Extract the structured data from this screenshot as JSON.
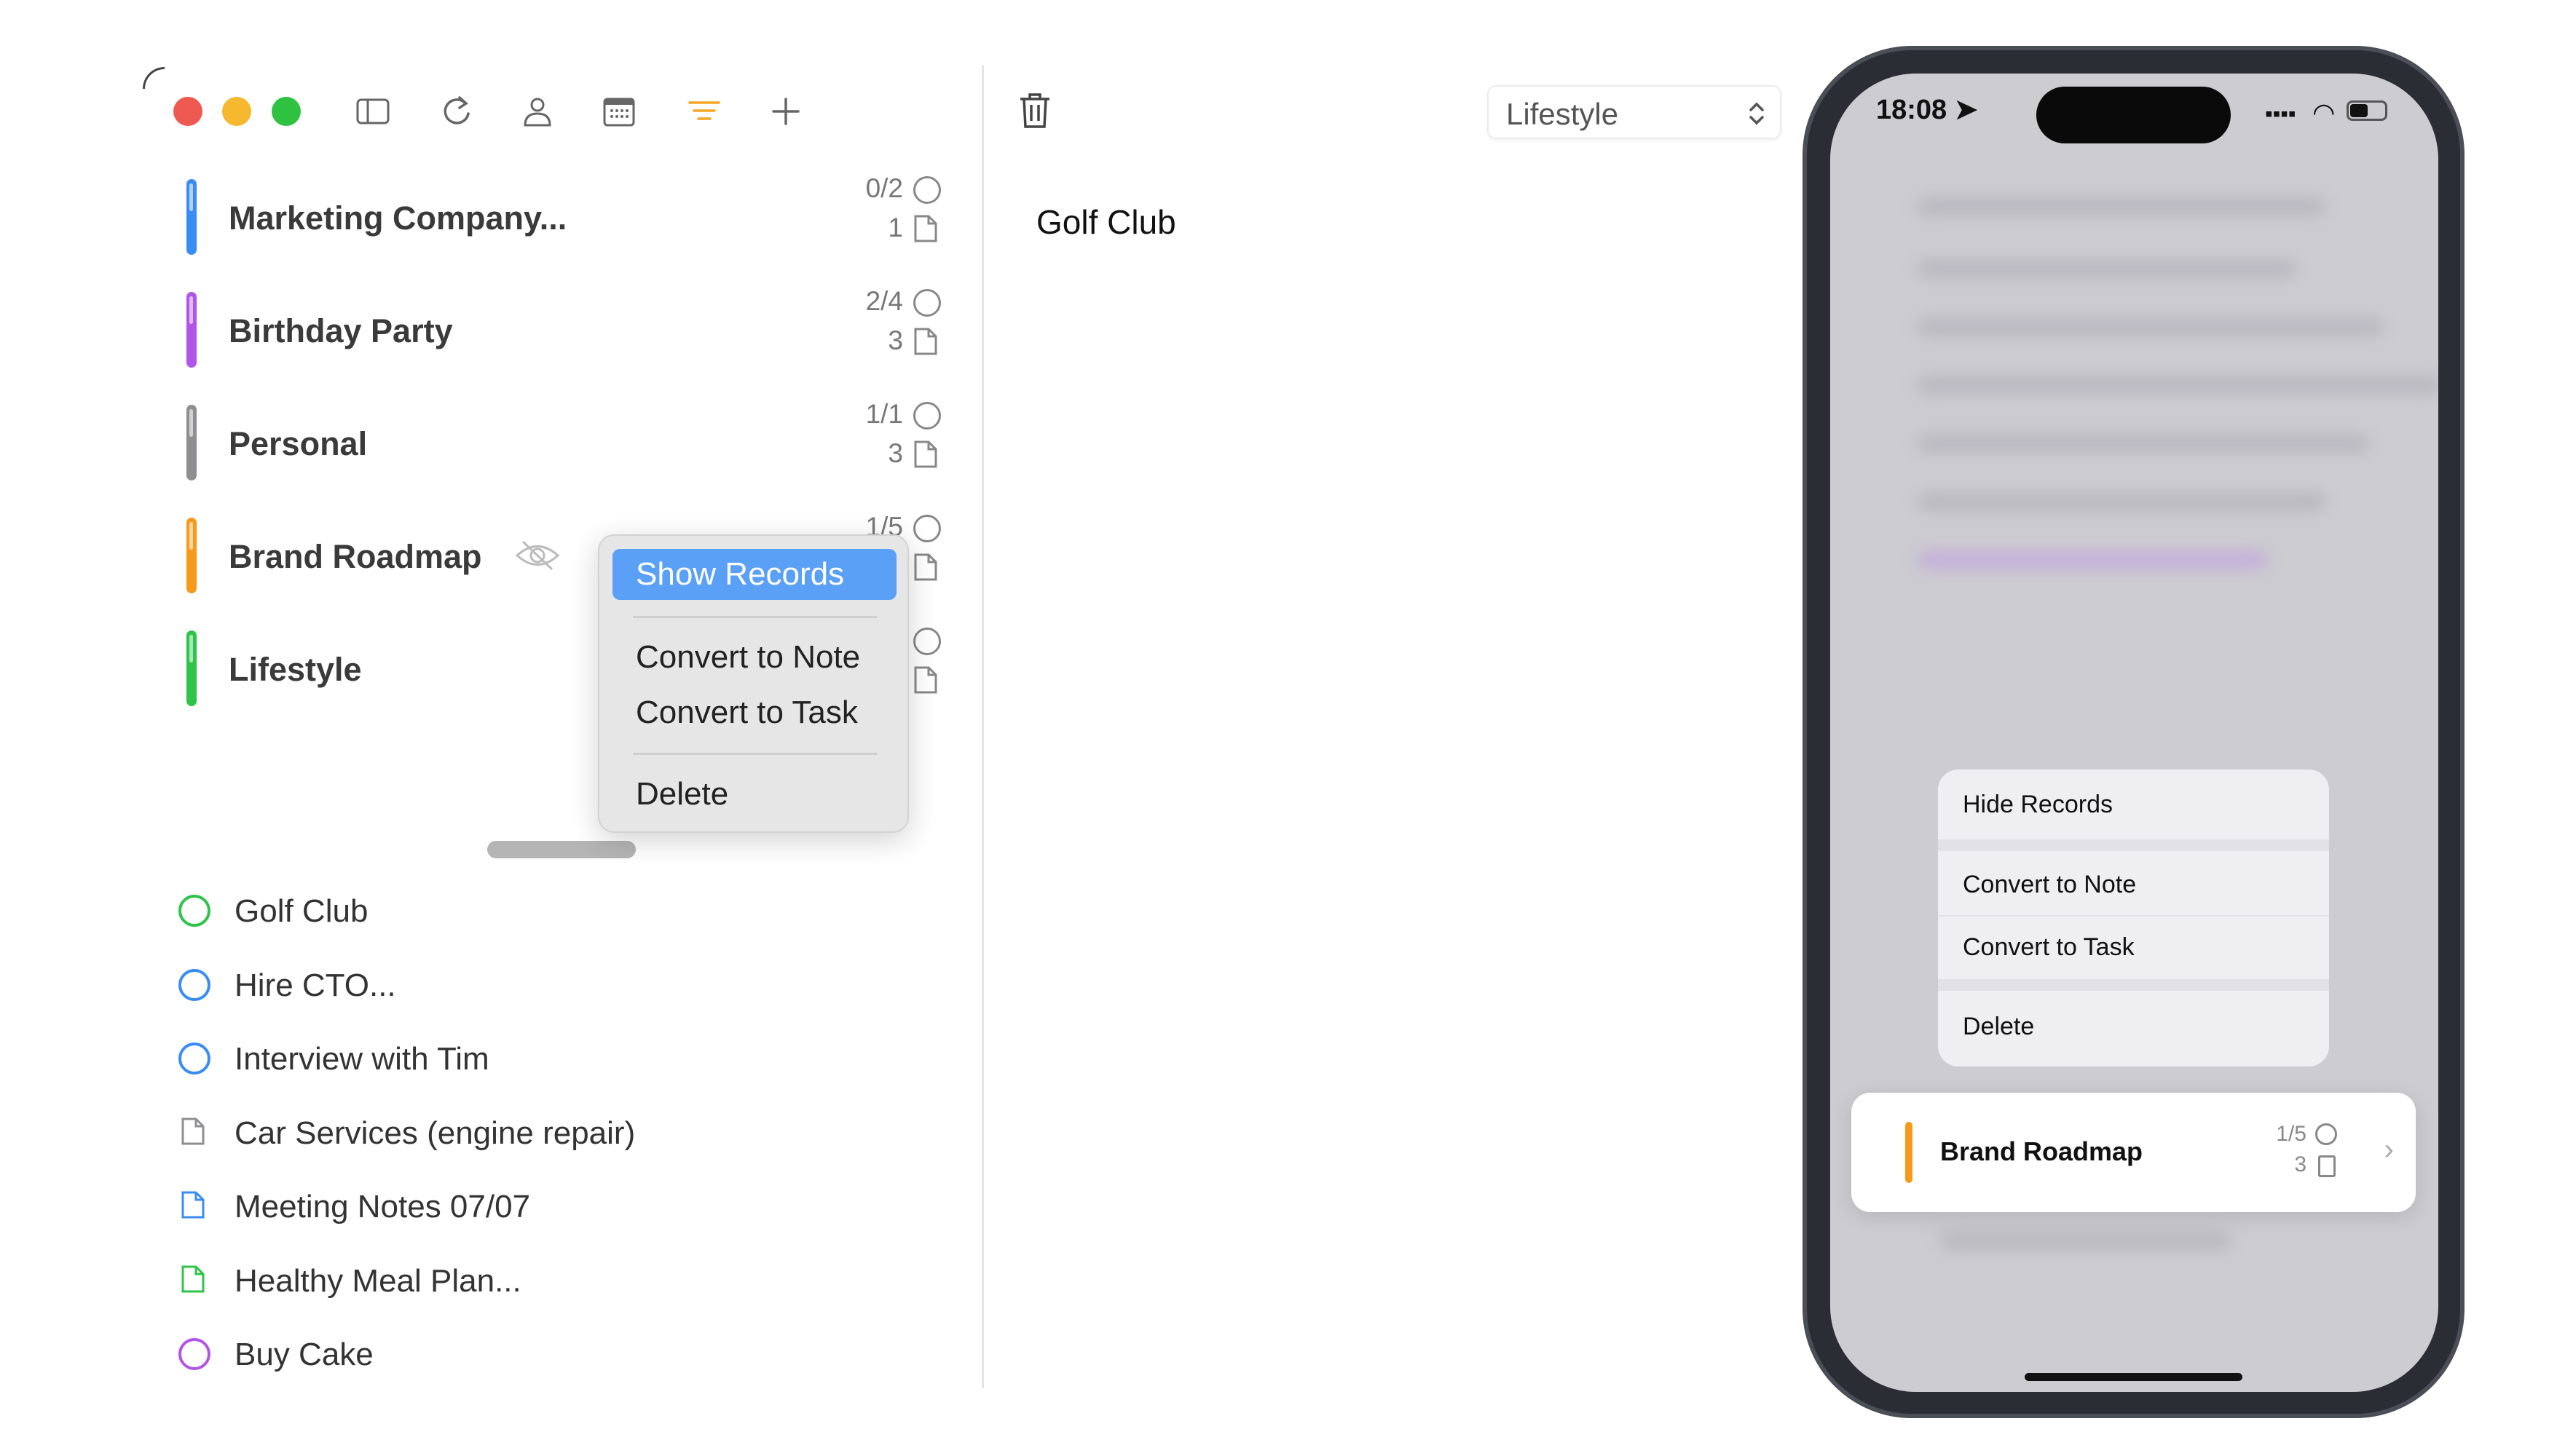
{
  "toolbar": {
    "icons": [
      "sidebar-icon",
      "refresh-icon",
      "person-icon",
      "calendar-icon",
      "filter-icon",
      "plus-icon"
    ],
    "accent": "#f5a623"
  },
  "window_controls": {
    "close": "#ee5a52",
    "minimize": "#f5b82e",
    "zoom": "#2fc240"
  },
  "projects": [
    {
      "title": "Marketing Company...",
      "tasks": "0/2",
      "notes": "1",
      "color": "#3a8cf5"
    },
    {
      "title": "Birthday Party",
      "tasks": "2/4",
      "notes": "3",
      "color": "#b155e8"
    },
    {
      "title": "Personal",
      "tasks": "1/1",
      "notes": "3",
      "color": "#8e8e93"
    },
    {
      "title": "Brand Roadmap",
      "tasks": "1/5",
      "notes": "",
      "color": "#f59a1b"
    },
    {
      "title": "Lifestyle",
      "tasks": "",
      "notes": "",
      "color": "#2ec44a"
    }
  ],
  "context_menu": {
    "items": [
      "Show Records",
      "Convert to Note",
      "Convert to Task",
      "Delete"
    ],
    "highlight": "#5aa0f7"
  },
  "records": [
    {
      "title": "Golf Club",
      "type": "task",
      "color": "#2ec44a"
    },
    {
      "title": "Hire CTO...",
      "type": "task",
      "color": "#3a8cf5"
    },
    {
      "title": "Interview with Tim",
      "type": "task",
      "color": "#3a8cf5"
    },
    {
      "title": "Car Services (engine repair)",
      "type": "note",
      "color": "#8e8e93"
    },
    {
      "title": "Meeting Notes 07/07",
      "type": "note",
      "color": "#3a8cf5"
    },
    {
      "title": "Healthy Meal Plan...",
      "type": "note",
      "color": "#2ec44a"
    },
    {
      "title": "Buy Cake",
      "type": "task",
      "color": "#b155e8"
    }
  ],
  "detail": {
    "title": "Golf Club",
    "project_select": "Lifestyle"
  },
  "phone": {
    "time": "18:08",
    "menu": [
      "Hide Records",
      "Convert to Note",
      "Convert to Task",
      "Delete"
    ],
    "card": {
      "title": "Brand Roadmap",
      "tasks": "1/5",
      "notes": "3",
      "color": "#f59a1b"
    }
  }
}
